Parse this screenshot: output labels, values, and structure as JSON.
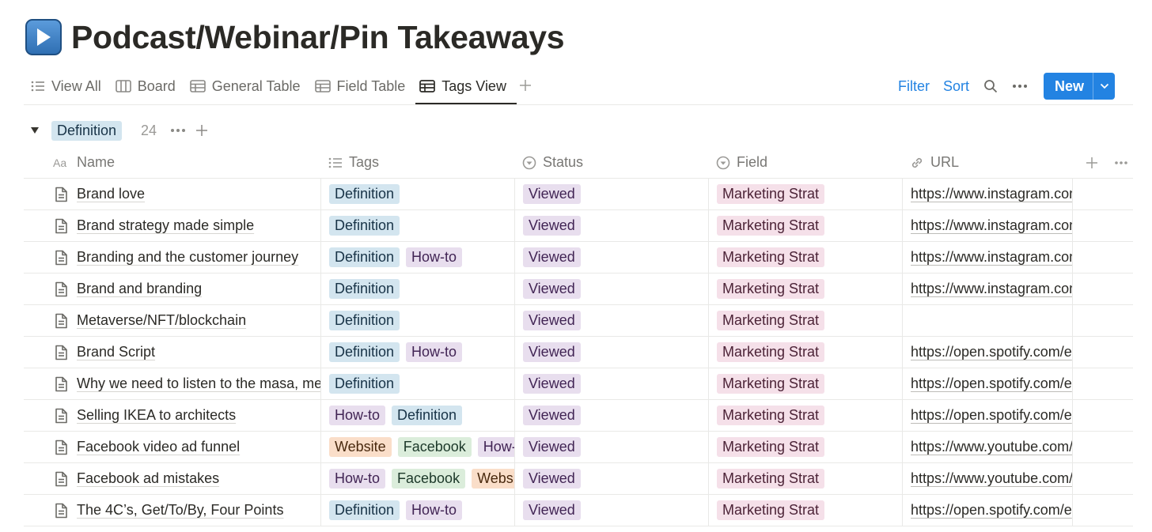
{
  "page": {
    "title": "Podcast/Webinar/Pin Takeaways",
    "icon": "play-button-emoji"
  },
  "tabs": [
    {
      "label": "View All",
      "icon": "list-icon"
    },
    {
      "label": "Board",
      "icon": "board-icon"
    },
    {
      "label": "General Table",
      "icon": "table-icon"
    },
    {
      "label": "Field Table",
      "icon": "table-icon"
    },
    {
      "label": "Tags View",
      "icon": "table-icon",
      "active": true
    }
  ],
  "toolbar": {
    "filter_label": "Filter",
    "sort_label": "Sort",
    "new_label": "New",
    "accent": "#2383e2"
  },
  "group": {
    "label": "Definition",
    "count": "24"
  },
  "columns": {
    "name": "Name",
    "tags": "Tags",
    "status": "Status",
    "field": "Field",
    "url": "URL"
  },
  "tag_colors": {
    "Definition": {
      "bg": "#d3e5ef",
      "fg": "#183347"
    },
    "How-to": {
      "bg": "#e8deee",
      "fg": "#412454"
    },
    "Website": {
      "bg": "#fadec9",
      "fg": "#49290e"
    },
    "Facebook": {
      "bg": "#dbeddb",
      "fg": "#1c3829"
    },
    "Viewed": {
      "bg": "#e8deee",
      "fg": "#412454"
    },
    "Marketing Strat": {
      "bg": "#f5e0e9",
      "fg": "#4c2337"
    }
  },
  "rows": [
    {
      "name": "Brand love",
      "tags": [
        "Definition"
      ],
      "status": "Viewed",
      "field": "Marketing Strat",
      "url": "https://www.instagram.com/"
    },
    {
      "name": "Brand strategy made simple",
      "tags": [
        "Definition"
      ],
      "status": "Viewed",
      "field": "Marketing Strat",
      "url": "https://www.instagram.com/"
    },
    {
      "name": "Branding and the customer journey",
      "tags": [
        "Definition",
        "How-to"
      ],
      "status": "Viewed",
      "field": "Marketing Strat",
      "url": "https://www.instagram.com/"
    },
    {
      "name": "Brand and branding",
      "tags": [
        "Definition"
      ],
      "status": "Viewed",
      "field": "Marketing Strat",
      "url": "https://www.instagram.com/"
    },
    {
      "name": "Metaverse/NFT/blockchain",
      "tags": [
        "Definition"
      ],
      "status": "Viewed",
      "field": "Marketing Strat",
      "url": ""
    },
    {
      "name": "Brand Script",
      "tags": [
        "Definition",
        "How-to"
      ],
      "status": "Viewed",
      "field": "Marketing Strat",
      "url": "https://open.spotify.com/e"
    },
    {
      "name": "Why we need to listen to the masa, me",
      "tags": [
        "Definition"
      ],
      "status": "Viewed",
      "field": "Marketing Strat",
      "url": "https://open.spotify.com/e"
    },
    {
      "name": "Selling IKEA to architects",
      "tags": [
        "How-to",
        "Definition"
      ],
      "status": "Viewed",
      "field": "Marketing Strat",
      "url": "https://open.spotify.com/e"
    },
    {
      "name": "Facebook video ad funnel",
      "tags": [
        "Website",
        "Facebook",
        "How-to"
      ],
      "status": "Viewed",
      "field": "Marketing Strat",
      "url": "https://www.youtube.com/"
    },
    {
      "name": "Facebook ad mistakes",
      "tags": [
        "How-to",
        "Facebook",
        "Website"
      ],
      "status": "Viewed",
      "field": "Marketing Strat",
      "url": "https://www.youtube.com/"
    },
    {
      "name": "The 4C’s, Get/To/By, Four Points",
      "tags": [
        "Definition",
        "How-to"
      ],
      "status": "Viewed",
      "field": "Marketing Strat",
      "url": "https://open.spotify.com/e"
    }
  ]
}
